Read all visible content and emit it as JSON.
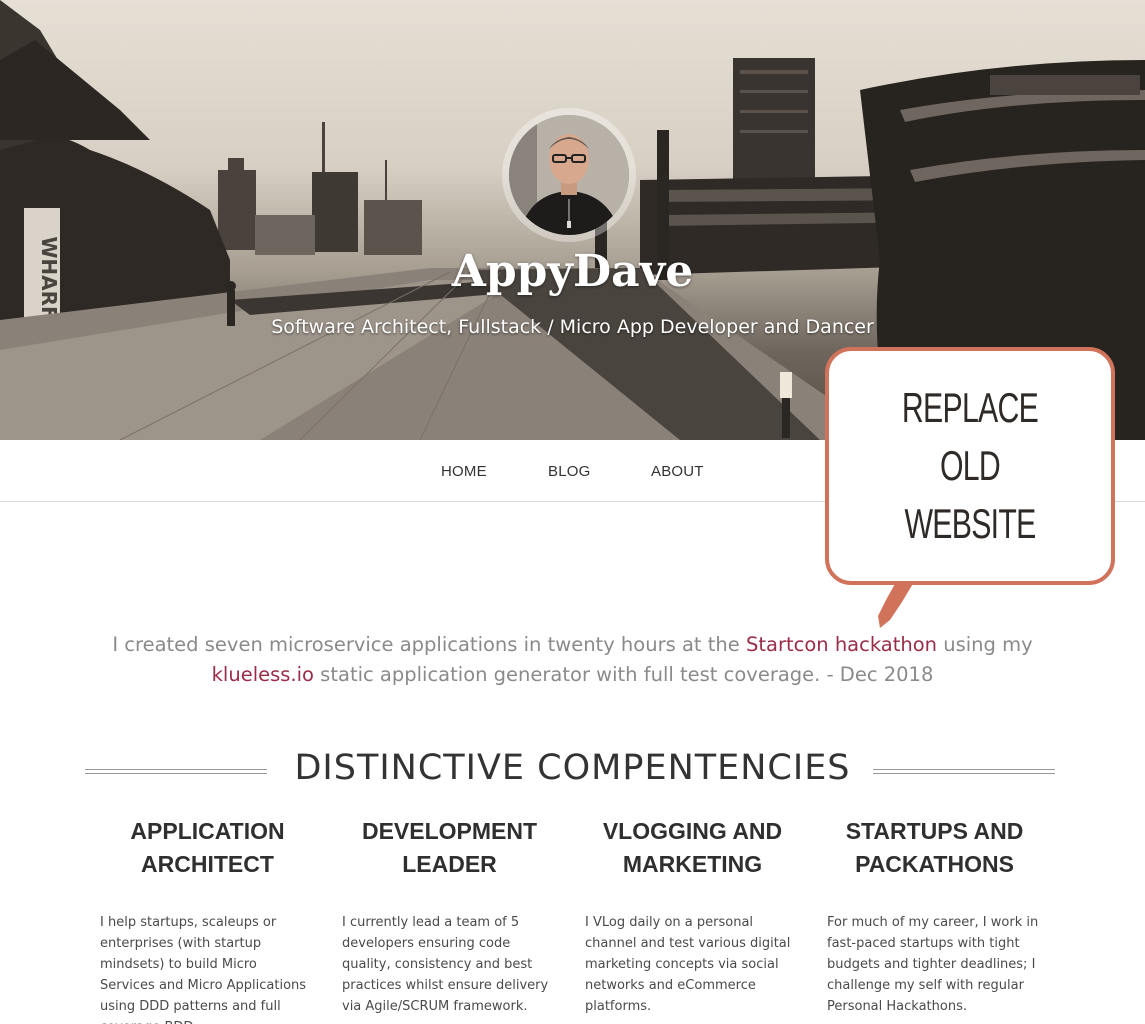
{
  "hero": {
    "title": "AppyDave",
    "subtitle": "Software Architect, Fullstack / Micro App Developer and Dancer",
    "sign_text": "WHARF"
  },
  "nav": {
    "items": [
      "HOME",
      "BLOG",
      "ABOUT"
    ]
  },
  "callout": {
    "line1": "REPLACE OLD",
    "line2": "WEBSITE",
    "border_color": "#d0735a"
  },
  "quote": {
    "part1": "I created seven microservice applications in twenty hours at the ",
    "link1": "Startcon hackathon",
    "part2": " using my ",
    "link2": "klueless.io",
    "part3": " static application generator with full test coverage. - Dec 2018",
    "link_color": "#9b2c48"
  },
  "section": {
    "heading": "DISTINCTIVE COMPENTENCIES"
  },
  "columns": [
    {
      "title": "APPLICATION ARCHITECT",
      "body": "I help startups, scaleups or enterprises (with startup mindsets) to build Micro Services and Micro Applications using DDD patterns and full coverage BDD."
    },
    {
      "title": "DEVELOPMENT LEADER",
      "body": "I currently lead a team of 5 developers ensuring code quality, consistency and best practices whilst ensure delivery via Agile/SCRUM framework."
    },
    {
      "title": "VLOGGING AND MARKETING",
      "body": "I VLog daily on a personal channel and test various digital marketing concepts via social networks and eCommerce platforms."
    },
    {
      "title": "STARTUPS AND PACKATHONS",
      "body": "For much of my career, I work in fast-paced startups with tight budgets and tighter deadlines; I challenge my self with regular Personal Hackathons."
    }
  ]
}
